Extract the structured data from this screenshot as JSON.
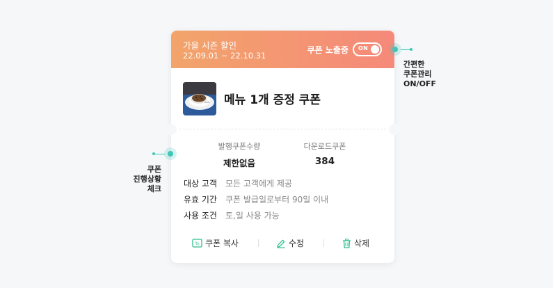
{
  "coupon": {
    "title": "가을 시즌 할인",
    "period": "22.09.01 ~ 22.10.31",
    "exposure_label": "쿠폰 노출중",
    "toggle_text": "ON",
    "name": "메뉴 1개 증정 쿠폰",
    "stats": [
      {
        "label": "발행쿠폰수량",
        "value": "제한없음"
      },
      {
        "label": "다운로드쿠폰",
        "value": "384"
      }
    ],
    "details": [
      {
        "key": "대상 고객",
        "value": "모든 고객에게 제공"
      },
      {
        "key": "유효 기간",
        "value": "쿠폰 발급일로부터 90일 이내"
      },
      {
        "key": "사용 조건",
        "value": "토,일 사용 가능"
      }
    ],
    "actions": {
      "copy": "쿠폰 복사",
      "edit": "수정",
      "delete": "삭제"
    }
  },
  "annotations": {
    "right": [
      "간편한",
      "쿠폰관리",
      "ON/OFF"
    ],
    "left": [
      "쿠폰",
      "진행상황",
      "체크"
    ]
  },
  "colors": {
    "header_start": "#f2a46a",
    "header_end": "#f5897a",
    "accent_teal": "#3ec6b8",
    "icon_green": "#2fbf8f"
  }
}
